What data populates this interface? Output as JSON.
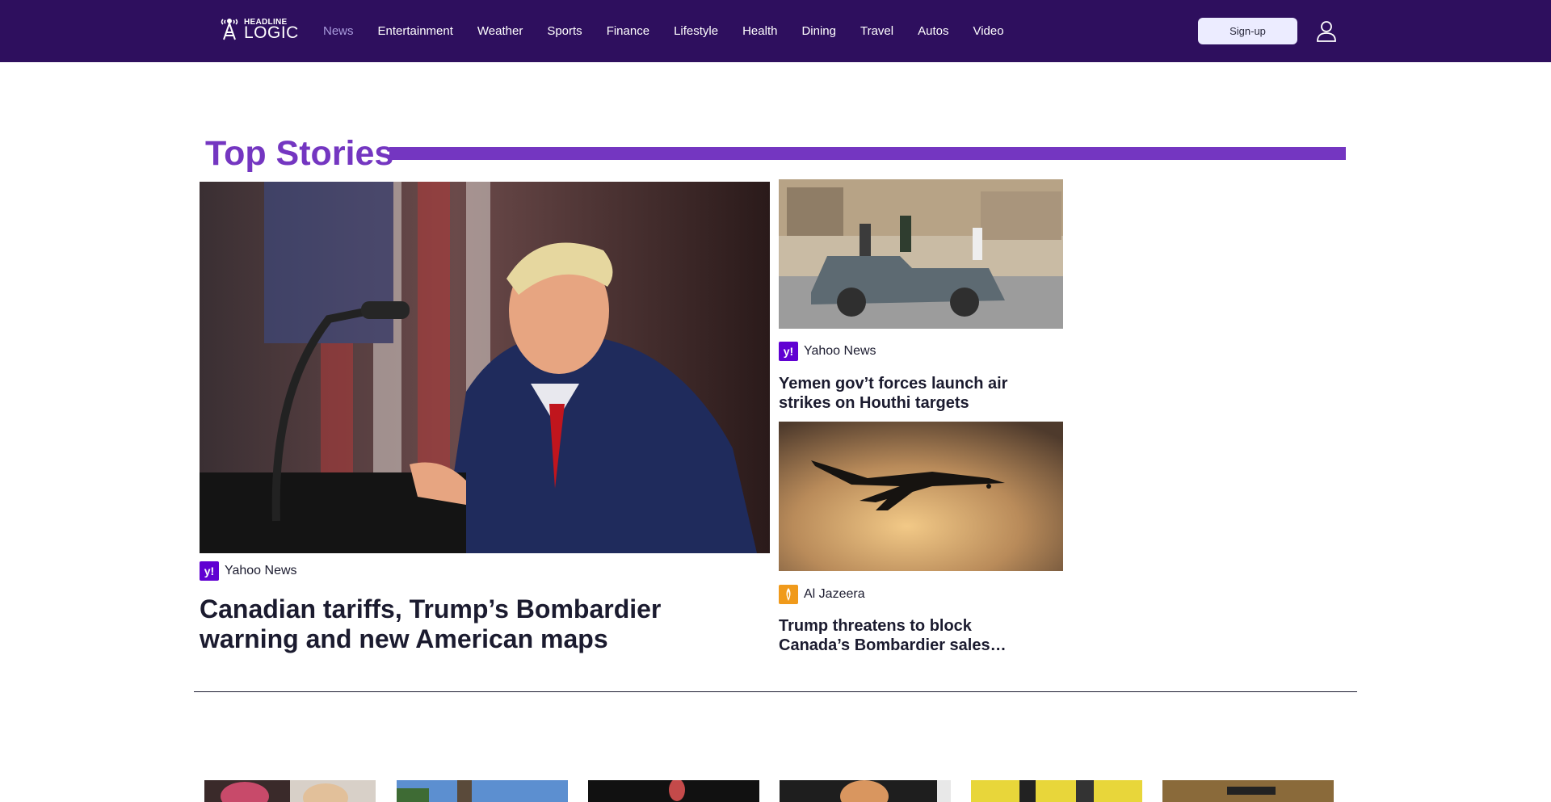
{
  "brand": {
    "logo_top": "HEADLINE",
    "logo_main": "LOGIC"
  },
  "nav": {
    "items": [
      {
        "label": "News",
        "active": true
      },
      {
        "label": "Entertainment"
      },
      {
        "label": "Weather"
      },
      {
        "label": "Sports"
      },
      {
        "label": "Finance"
      },
      {
        "label": "Lifestyle"
      },
      {
        "label": "Health"
      },
      {
        "label": "Dining"
      },
      {
        "label": "Travel"
      },
      {
        "label": "Autos"
      },
      {
        "label": "Video"
      }
    ],
    "signup_label": "Sign-up"
  },
  "top_stories": {
    "title": "Top Stories",
    "hero": {
      "source": "Yahoo News",
      "headline": "Canadian tariffs, Trump’s Bombardier warning and new American maps"
    },
    "side": [
      {
        "source": "Yahoo News",
        "headline": "Yemen gov’t forces launch air strikes on Houthi targets"
      },
      {
        "source": "Al Jazeera",
        "headline": "Trump threatens to block Canada’s Bombardier sales…"
      }
    ]
  },
  "colors": {
    "header_bg": "#2e0f5e",
    "accent": "#7436c1",
    "active_nav": "#a99bdc",
    "yahoo": "#6001d2",
    "aljazeera": "#f09a1b"
  },
  "icons": {
    "user": "user-icon",
    "logo": "logo-icon"
  }
}
